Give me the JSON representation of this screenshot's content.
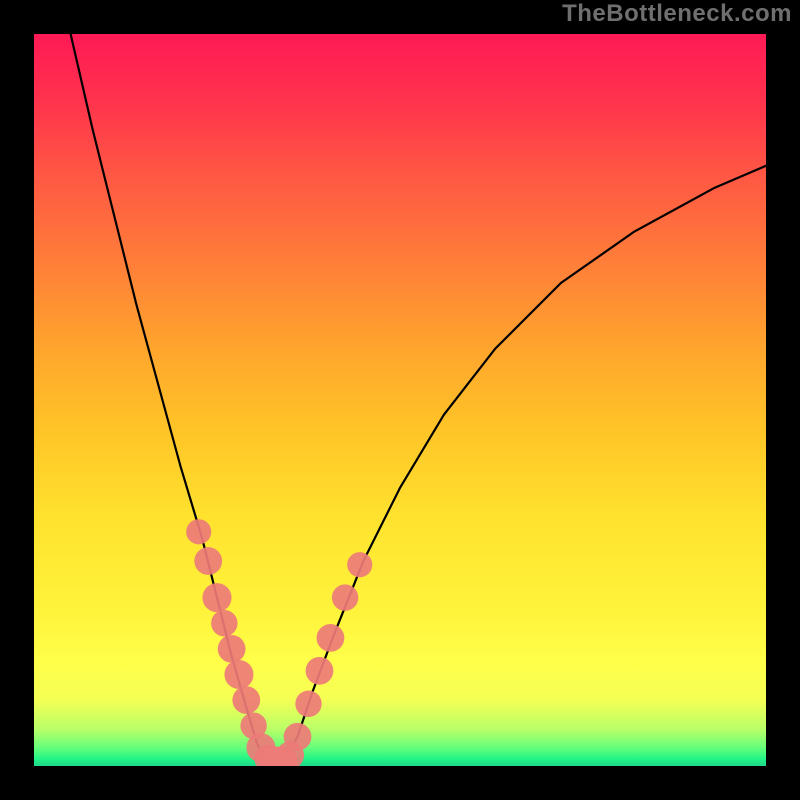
{
  "watermark": "TheBottleneck.com",
  "colors": {
    "gradient_top": "#ff1a55",
    "gradient_mid": "#ffe22e",
    "gradient_bottom": "#1dd98a",
    "curve": "#000000",
    "marker": "#ed7b78",
    "background": "#000000"
  },
  "chart_data": {
    "type": "line",
    "title": "",
    "xlabel": "",
    "ylabel": "",
    "xlim": [
      0,
      100
    ],
    "ylim": [
      0,
      100
    ],
    "grid": false,
    "legend": false,
    "series": [
      {
        "name": "left-branch",
        "x": [
          5,
          8,
          11,
          14,
          17,
          20,
          23,
          25,
          27,
          29,
          30.5,
          31.5,
          32
        ],
        "y": [
          100,
          87,
          75,
          63,
          52,
          41,
          31,
          23,
          15,
          8,
          3,
          1,
          0.5
        ]
      },
      {
        "name": "right-branch",
        "x": [
          34,
          36,
          38,
          41,
          45,
          50,
          56,
          63,
          72,
          82,
          93,
          100
        ],
        "y": [
          0.5,
          4,
          10,
          18,
          28,
          38,
          48,
          57,
          66,
          73,
          79,
          82
        ]
      }
    ],
    "markers": [
      {
        "x": 22.5,
        "y": 32,
        "r": 1.3
      },
      {
        "x": 23.8,
        "y": 28,
        "r": 1.5
      },
      {
        "x": 25.0,
        "y": 23,
        "r": 1.6
      },
      {
        "x": 26.0,
        "y": 19.5,
        "r": 1.4
      },
      {
        "x": 27.0,
        "y": 16,
        "r": 1.5
      },
      {
        "x": 28.0,
        "y": 12.5,
        "r": 1.6
      },
      {
        "x": 29.0,
        "y": 9,
        "r": 1.5
      },
      {
        "x": 30.0,
        "y": 5.5,
        "r": 1.4
      },
      {
        "x": 31.0,
        "y": 2.5,
        "r": 1.6
      },
      {
        "x": 32.0,
        "y": 1.0,
        "r": 1.5
      },
      {
        "x": 33.0,
        "y": 0.7,
        "r": 1.6
      },
      {
        "x": 34.0,
        "y": 0.7,
        "r": 1.6
      },
      {
        "x": 35.0,
        "y": 1.5,
        "r": 1.5
      },
      {
        "x": 36.0,
        "y": 4.0,
        "r": 1.5
      },
      {
        "x": 37.5,
        "y": 8.5,
        "r": 1.4
      },
      {
        "x": 39.0,
        "y": 13,
        "r": 1.5
      },
      {
        "x": 40.5,
        "y": 17.5,
        "r": 1.5
      },
      {
        "x": 42.5,
        "y": 23,
        "r": 1.4
      },
      {
        "x": 44.5,
        "y": 27.5,
        "r": 1.3
      }
    ],
    "baseline_marker_run": {
      "x_start": 31.5,
      "x_end": 35.0,
      "y": 0.7
    }
  }
}
